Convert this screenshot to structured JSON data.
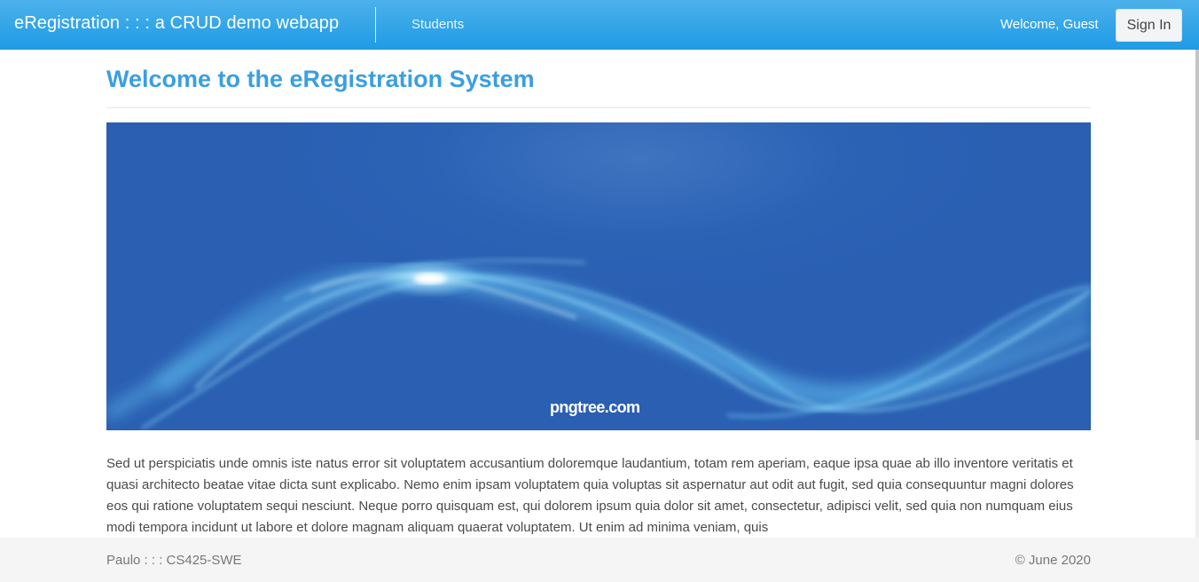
{
  "navbar": {
    "brand": "eRegistration : : : a CRUD demo webapp",
    "nav_items": [
      "Students"
    ],
    "welcome": "Welcome, Guest",
    "signin_label": "Sign In"
  },
  "main": {
    "title": "Welcome to the eRegistration System",
    "banner": {
      "watermark": "pngtree.com"
    },
    "paragraph": "Sed ut perspiciatis unde omnis iste natus error sit voluptatem accusantium doloremque laudantium, totam rem aperiam, eaque ipsa quae ab illo inventore veritatis et quasi architecto beatae vitae dicta sunt explicabo. Nemo enim ipsam voluptatem quia voluptas sit aspernatur aut odit aut fugit, sed quia consequuntur magni dolores eos qui ratione voluptatem sequi nesciunt. Neque porro quisquam est, qui dolorem ipsum quia dolor sit amet, consectetur, adipisci velit, sed quia non numquam eius modi tempora incidunt ut labore et dolore magnam aliquam quaerat voluptatem. Ut enim ad minima veniam, quis"
  },
  "footer": {
    "left": "Paulo : : : CS425-SWE",
    "right": "© June 2020"
  },
  "colors": {
    "navbar_top": "#4cb1eb",
    "navbar_bottom": "#1e9be6",
    "title": "#3a9fe0",
    "banner": "#2a5fb2",
    "footer_bg": "#f5f5f5"
  }
}
